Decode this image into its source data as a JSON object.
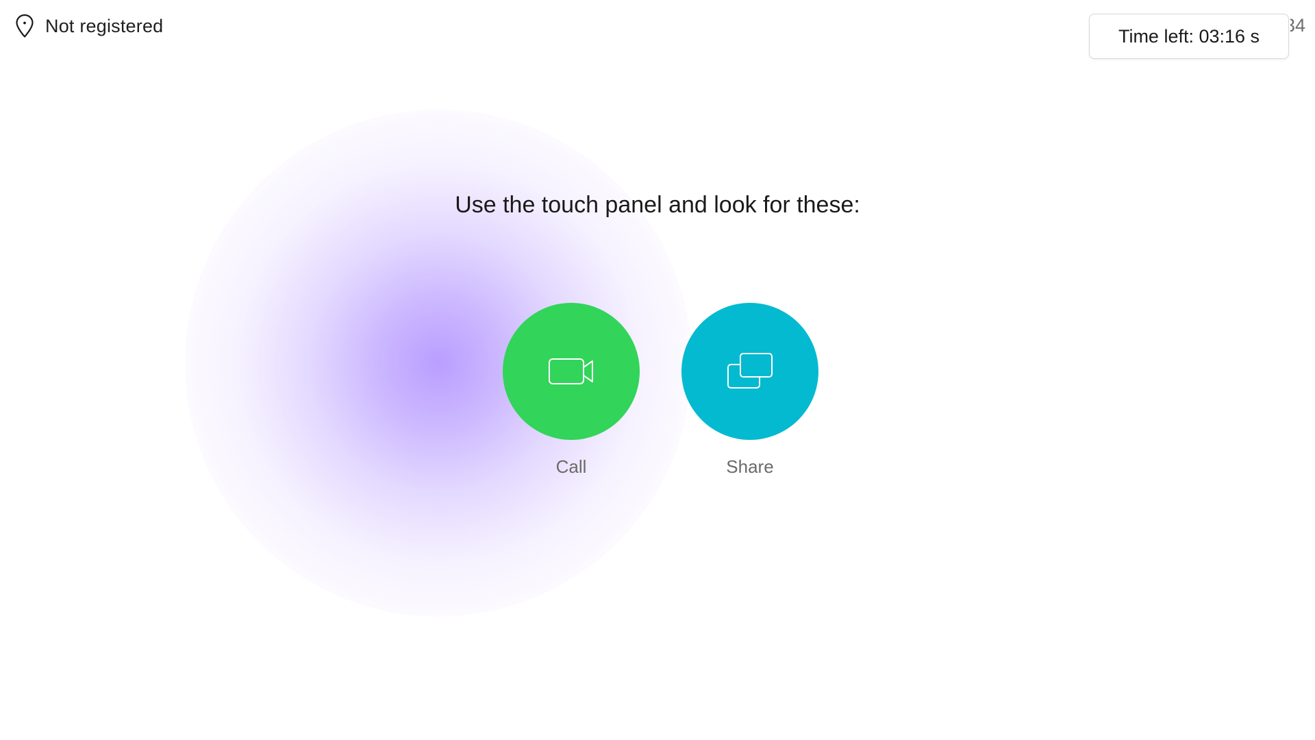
{
  "status": {
    "icon": "location-pin-icon",
    "text": "Not registered"
  },
  "clock_partial": "34",
  "timer": {
    "text": "Time left: 03:16 s"
  },
  "prompt": "Use the touch panel and look for these:",
  "actions": [
    {
      "label": "Call",
      "icon": "video-camera-icon",
      "color": "#32D45A"
    },
    {
      "label": "Share",
      "icon": "share-screen-icon",
      "color": "#04BAD0"
    }
  ],
  "colors": {
    "glow": "#C0A8FF",
    "label_text": "#6A6A6A"
  }
}
